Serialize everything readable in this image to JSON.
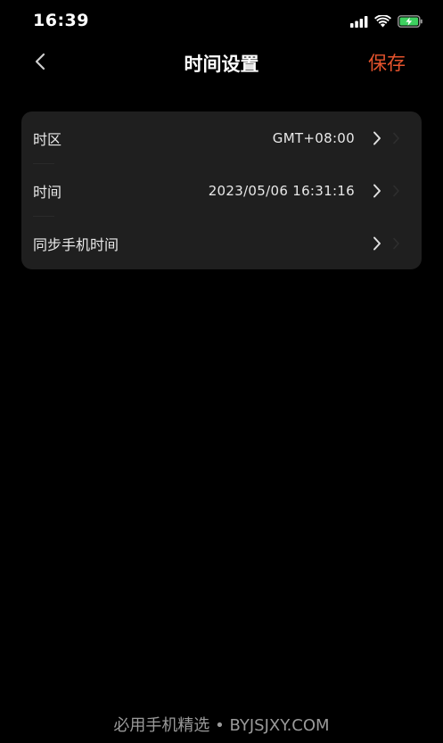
{
  "status_bar": {
    "time": "16:39"
  },
  "nav": {
    "title": "时间设置",
    "save_label": "保存",
    "accent_color": "#e5532d"
  },
  "settings": {
    "rows": [
      {
        "label": "时区",
        "value": "GMT+08:00"
      },
      {
        "label": "时间",
        "value": "2023/05/06 16:31:16"
      },
      {
        "label": "同步手机时间",
        "value": ""
      }
    ]
  },
  "watermark": {
    "text": "必用手机精选 • BYJSJXY.COM"
  },
  "icons": {
    "back": "chevron-left-icon",
    "row_arrow": "chevron-right-icon",
    "signal": "cellular-signal-icon",
    "wifi": "wifi-icon",
    "battery": "battery-charging-icon"
  }
}
